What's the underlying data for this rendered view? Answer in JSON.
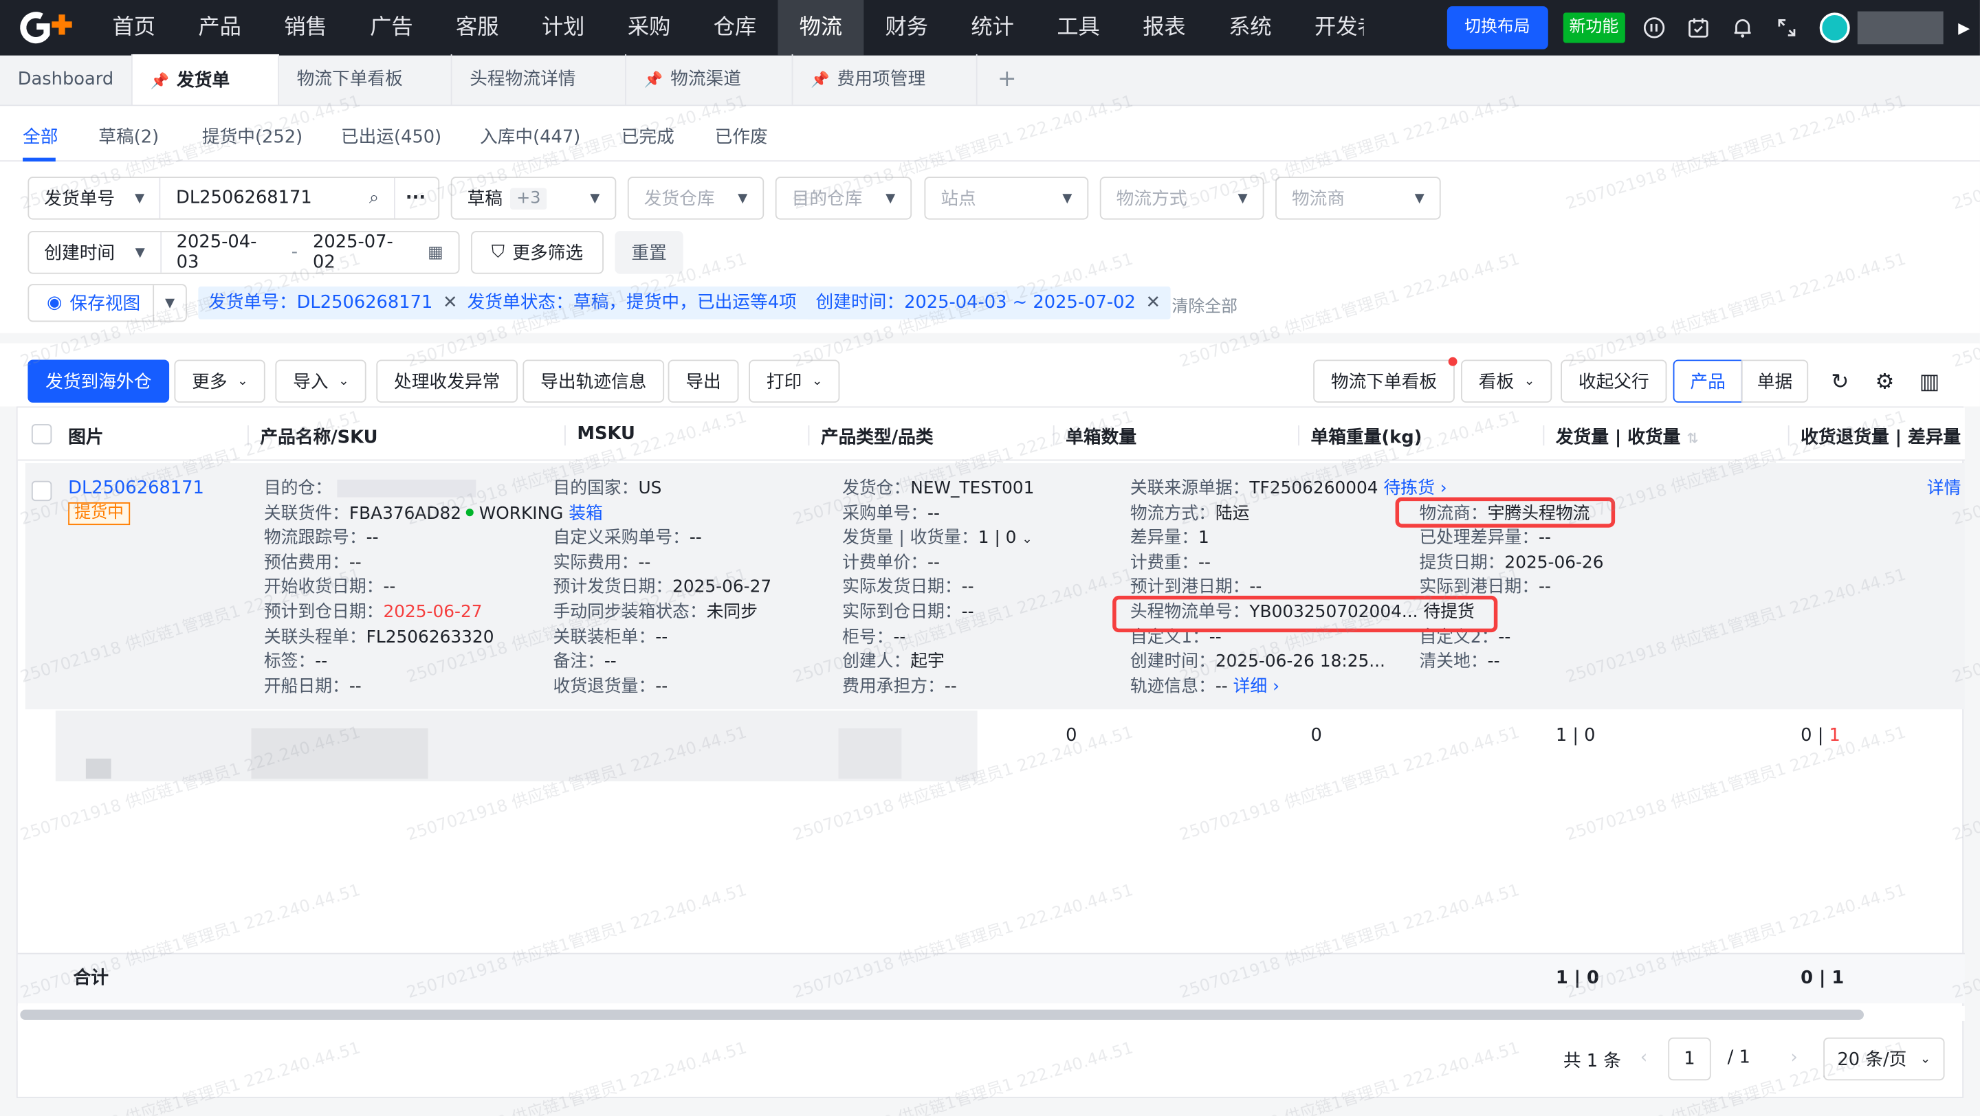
{
  "topnav": {
    "items": [
      "首页",
      "产品",
      "销售",
      "广告",
      "客服",
      "计划",
      "采购",
      "仓库",
      "物流",
      "财务",
      "统计",
      "工具",
      "报表",
      "系统",
      "开发者"
    ],
    "active": "物流",
    "switch_layout": "切换布局",
    "new_feature": "新功能"
  },
  "page_tabs": [
    {
      "label": "Dashboard",
      "pinned": false,
      "active": false
    },
    {
      "label": "发货单",
      "pinned": true,
      "active": true
    },
    {
      "label": "物流下单看板",
      "pinned": false,
      "active": false
    },
    {
      "label": "头程物流详情",
      "pinned": false,
      "active": false
    },
    {
      "label": "物流渠道",
      "pinned": true,
      "active": false
    },
    {
      "label": "费用项管理",
      "pinned": true,
      "active": false
    }
  ],
  "status_tabs": [
    "全部",
    "草稿(2)",
    "提货中(252)",
    "已出运(450)",
    "入库中(447)",
    "已完成",
    "已作废"
  ],
  "filters": {
    "search_field": "发货单号",
    "search_value": "DL2506268171",
    "status_value": "草稿",
    "status_more": "+3",
    "ship_warehouse": "发货仓库",
    "dest_warehouse": "目的仓库",
    "site": "站点",
    "logistics_method": "物流方式",
    "carrier": "物流商",
    "date_field": "创建时间",
    "date_start": "2025-04-03",
    "date_sep": "-",
    "date_end": "2025-07-02",
    "more_filters": "更多筛选",
    "reset": "重置",
    "save_view": "保存视图",
    "chips": [
      "发货单号：DL2506268171",
      "发货单状态：草稿，提货中，已出运等4项",
      "创建时间：2025-04-03 ~ 2025-07-02"
    ],
    "clear_all": "清除全部"
  },
  "toolbar": {
    "ship_overseas": "发货到海外仓",
    "more": "更多",
    "import": "导入",
    "handle_exception": "处理收发异常",
    "export_track": "导出轨迹信息",
    "export": "导出",
    "print": "打印",
    "order_board": "物流下单看板",
    "board": "看板",
    "collapse_parent": "收起父行",
    "view_product": "产品",
    "view_doc": "单据"
  },
  "table": {
    "headers": [
      "图片",
      "产品名称/SKU",
      "MSKU",
      "产品类型/品类",
      "单箱数量",
      "单箱重量(kg)",
      "发货量 | 收货量",
      "收货退货量 | 差异量"
    ],
    "row": {
      "id": "DL2506268171",
      "status": "提货中",
      "detail": "详情",
      "col1": [
        [
          "目的仓：",
          ""
        ],
        [
          "关联货件：",
          "FBA376AD82"
        ],
        [
          "物流跟踪号：",
          "--"
        ],
        [
          "预估费用：",
          "--"
        ],
        [
          "开始收货日期：",
          "--"
        ],
        [
          "预计到仓日期：",
          "2025-06-27"
        ],
        [
          "关联头程单：",
          "FL2506263320"
        ],
        [
          "标签：",
          "--"
        ],
        [
          "开船日期：",
          "--"
        ]
      ],
      "shipment_state": "WORKING",
      "shipment_action": "装箱",
      "col2": [
        [
          "目的国家：",
          "US"
        ],
        [
          "",
          ""
        ],
        [
          "自定义采购单号：",
          "--"
        ],
        [
          "实际费用：",
          "--"
        ],
        [
          "预计发货日期：",
          "2025-06-27"
        ],
        [
          "手动同步装箱状态：",
          "未同步"
        ],
        [
          "关联装柜单：",
          "--"
        ],
        [
          "备注：",
          "--"
        ],
        [
          "收货退货量：",
          "--"
        ]
      ],
      "col3": [
        [
          "发货仓：",
          "NEW_TEST001"
        ],
        [
          "采购单号：",
          "--"
        ],
        [
          "发货量 | 收货量：",
          "1 | 0"
        ],
        [
          "计费单价：",
          "--"
        ],
        [
          "实际发货日期：",
          "--"
        ],
        [
          "实际到仓日期：",
          "--"
        ],
        [
          "柜号：",
          "--"
        ],
        [
          "创建人：",
          "起宇"
        ],
        [
          "费用承担方：",
          "--"
        ]
      ],
      "col4": [
        [
          "关联来源单据：",
          "TF2506260004"
        ],
        [
          "物流方式：",
          "陆运"
        ],
        [
          "差异量：",
          "1"
        ],
        [
          "计费重：",
          "--"
        ],
        [
          "预计到港日期：",
          "--"
        ],
        [
          "头程物流单号：",
          "YB003250702004..."
        ],
        [
          "自定义1：",
          "--"
        ],
        [
          "创建时间：",
          "2025-06-26 18:25..."
        ],
        [
          "轨迹信息：",
          "--"
        ]
      ],
      "source_status": "待拣货",
      "tracking_status": "待提货",
      "track_detail": "详细",
      "col5": [
        [
          "",
          ""
        ],
        [
          "物流商：",
          "宇腾头程物流"
        ],
        [
          "已处理差异量：",
          "--"
        ],
        [
          "提货日期：",
          "2025-06-26"
        ],
        [
          "实际到港日期：",
          "--"
        ],
        [
          "",
          ""
        ],
        [
          "自定义2：",
          "--"
        ],
        [
          "清关地：",
          "--"
        ]
      ]
    },
    "child": {
      "box_qty": "0",
      "box_weight": "0",
      "ship_recv": "1 | 0",
      "return_qty": "0",
      "diff_qty": "1"
    },
    "total_label": "合计",
    "total_ship_recv": "1 | 0",
    "total_return_diff": "0 | 1"
  },
  "pagination": {
    "total": "共 1 条",
    "current": "1",
    "of": "/ 1",
    "page_size": "20 条/页"
  },
  "watermark": "2507021918 供应链1管理员1 222.240.44.51",
  "colors": {
    "primary": "#165dff",
    "nav_bg": "#1d2129",
    "highlight": "#f53f3f",
    "success": "#00b42a",
    "warning": "#ff7d00"
  }
}
